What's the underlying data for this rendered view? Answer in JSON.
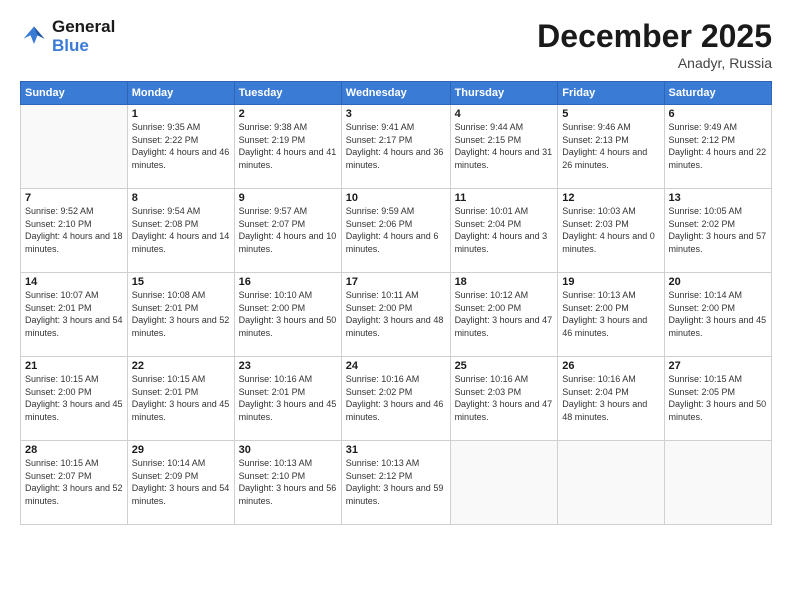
{
  "logo": {
    "line1": "General",
    "line2": "Blue"
  },
  "title": "December 2025",
  "subtitle": "Anadyr, Russia",
  "days_header": [
    "Sunday",
    "Monday",
    "Tuesday",
    "Wednesday",
    "Thursday",
    "Friday",
    "Saturday"
  ],
  "weeks": [
    [
      {
        "day": "",
        "sunrise": "",
        "sunset": "",
        "daylight": ""
      },
      {
        "day": "1",
        "sunrise": "Sunrise: 9:35 AM",
        "sunset": "Sunset: 2:22 PM",
        "daylight": "Daylight: 4 hours and 46 minutes."
      },
      {
        "day": "2",
        "sunrise": "Sunrise: 9:38 AM",
        "sunset": "Sunset: 2:19 PM",
        "daylight": "Daylight: 4 hours and 41 minutes."
      },
      {
        "day": "3",
        "sunrise": "Sunrise: 9:41 AM",
        "sunset": "Sunset: 2:17 PM",
        "daylight": "Daylight: 4 hours and 36 minutes."
      },
      {
        "day": "4",
        "sunrise": "Sunrise: 9:44 AM",
        "sunset": "Sunset: 2:15 PM",
        "daylight": "Daylight: 4 hours and 31 minutes."
      },
      {
        "day": "5",
        "sunrise": "Sunrise: 9:46 AM",
        "sunset": "Sunset: 2:13 PM",
        "daylight": "Daylight: 4 hours and 26 minutes."
      },
      {
        "day": "6",
        "sunrise": "Sunrise: 9:49 AM",
        "sunset": "Sunset: 2:12 PM",
        "daylight": "Daylight: 4 hours and 22 minutes."
      }
    ],
    [
      {
        "day": "7",
        "sunrise": "Sunrise: 9:52 AM",
        "sunset": "Sunset: 2:10 PM",
        "daylight": "Daylight: 4 hours and 18 minutes."
      },
      {
        "day": "8",
        "sunrise": "Sunrise: 9:54 AM",
        "sunset": "Sunset: 2:08 PM",
        "daylight": "Daylight: 4 hours and 14 minutes."
      },
      {
        "day": "9",
        "sunrise": "Sunrise: 9:57 AM",
        "sunset": "Sunset: 2:07 PM",
        "daylight": "Daylight: 4 hours and 10 minutes."
      },
      {
        "day": "10",
        "sunrise": "Sunrise: 9:59 AM",
        "sunset": "Sunset: 2:06 PM",
        "daylight": "Daylight: 4 hours and 6 minutes."
      },
      {
        "day": "11",
        "sunrise": "Sunrise: 10:01 AM",
        "sunset": "Sunset: 2:04 PM",
        "daylight": "Daylight: 4 hours and 3 minutes."
      },
      {
        "day": "12",
        "sunrise": "Sunrise: 10:03 AM",
        "sunset": "Sunset: 2:03 PM",
        "daylight": "Daylight: 4 hours and 0 minutes."
      },
      {
        "day": "13",
        "sunrise": "Sunrise: 10:05 AM",
        "sunset": "Sunset: 2:02 PM",
        "daylight": "Daylight: 3 hours and 57 minutes."
      }
    ],
    [
      {
        "day": "14",
        "sunrise": "Sunrise: 10:07 AM",
        "sunset": "Sunset: 2:01 PM",
        "daylight": "Daylight: 3 hours and 54 minutes."
      },
      {
        "day": "15",
        "sunrise": "Sunrise: 10:08 AM",
        "sunset": "Sunset: 2:01 PM",
        "daylight": "Daylight: 3 hours and 52 minutes."
      },
      {
        "day": "16",
        "sunrise": "Sunrise: 10:10 AM",
        "sunset": "Sunset: 2:00 PM",
        "daylight": "Daylight: 3 hours and 50 minutes."
      },
      {
        "day": "17",
        "sunrise": "Sunrise: 10:11 AM",
        "sunset": "Sunset: 2:00 PM",
        "daylight": "Daylight: 3 hours and 48 minutes."
      },
      {
        "day": "18",
        "sunrise": "Sunrise: 10:12 AM",
        "sunset": "Sunset: 2:00 PM",
        "daylight": "Daylight: 3 hours and 47 minutes."
      },
      {
        "day": "19",
        "sunrise": "Sunrise: 10:13 AM",
        "sunset": "Sunset: 2:00 PM",
        "daylight": "Daylight: 3 hours and 46 minutes."
      },
      {
        "day": "20",
        "sunrise": "Sunrise: 10:14 AM",
        "sunset": "Sunset: 2:00 PM",
        "daylight": "Daylight: 3 hours and 45 minutes."
      }
    ],
    [
      {
        "day": "21",
        "sunrise": "Sunrise: 10:15 AM",
        "sunset": "Sunset: 2:00 PM",
        "daylight": "Daylight: 3 hours and 45 minutes."
      },
      {
        "day": "22",
        "sunrise": "Sunrise: 10:15 AM",
        "sunset": "Sunset: 2:01 PM",
        "daylight": "Daylight: 3 hours and 45 minutes."
      },
      {
        "day": "23",
        "sunrise": "Sunrise: 10:16 AM",
        "sunset": "Sunset: 2:01 PM",
        "daylight": "Daylight: 3 hours and 45 minutes."
      },
      {
        "day": "24",
        "sunrise": "Sunrise: 10:16 AM",
        "sunset": "Sunset: 2:02 PM",
        "daylight": "Daylight: 3 hours and 46 minutes."
      },
      {
        "day": "25",
        "sunrise": "Sunrise: 10:16 AM",
        "sunset": "Sunset: 2:03 PM",
        "daylight": "Daylight: 3 hours and 47 minutes."
      },
      {
        "day": "26",
        "sunrise": "Sunrise: 10:16 AM",
        "sunset": "Sunset: 2:04 PM",
        "daylight": "Daylight: 3 hours and 48 minutes."
      },
      {
        "day": "27",
        "sunrise": "Sunrise: 10:15 AM",
        "sunset": "Sunset: 2:05 PM",
        "daylight": "Daylight: 3 hours and 50 minutes."
      }
    ],
    [
      {
        "day": "28",
        "sunrise": "Sunrise: 10:15 AM",
        "sunset": "Sunset: 2:07 PM",
        "daylight": "Daylight: 3 hours and 52 minutes."
      },
      {
        "day": "29",
        "sunrise": "Sunrise: 10:14 AM",
        "sunset": "Sunset: 2:09 PM",
        "daylight": "Daylight: 3 hours and 54 minutes."
      },
      {
        "day": "30",
        "sunrise": "Sunrise: 10:13 AM",
        "sunset": "Sunset: 2:10 PM",
        "daylight": "Daylight: 3 hours and 56 minutes."
      },
      {
        "day": "31",
        "sunrise": "Sunrise: 10:13 AM",
        "sunset": "Sunset: 2:12 PM",
        "daylight": "Daylight: 3 hours and 59 minutes."
      },
      {
        "day": "",
        "sunrise": "",
        "sunset": "",
        "daylight": ""
      },
      {
        "day": "",
        "sunrise": "",
        "sunset": "",
        "daylight": ""
      },
      {
        "day": "",
        "sunrise": "",
        "sunset": "",
        "daylight": ""
      }
    ]
  ]
}
